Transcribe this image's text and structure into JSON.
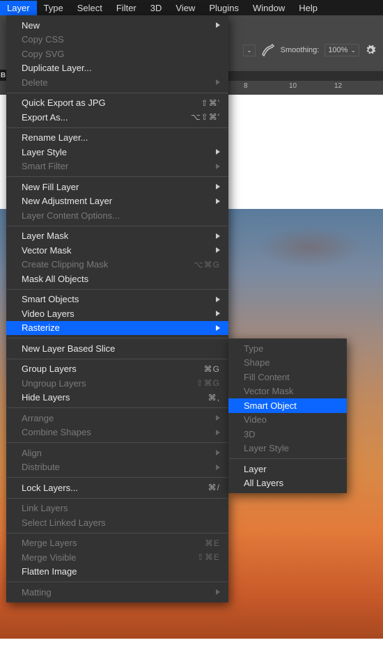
{
  "menubar": {
    "items": [
      {
        "label": "Layer"
      },
      {
        "label": "Type"
      },
      {
        "label": "Select"
      },
      {
        "label": "Filter"
      },
      {
        "label": "3D"
      },
      {
        "label": "View"
      },
      {
        "label": "Plugins"
      },
      {
        "label": "Window"
      },
      {
        "label": "Help"
      }
    ]
  },
  "toolbar": {
    "smoothing_label": "Smoothing:",
    "smoothing_value": "100%"
  },
  "ruler": {
    "marks": [
      "8",
      "10",
      "12"
    ]
  },
  "left_label": "B",
  "layer_menu": [
    {
      "label": "New",
      "arrow": true
    },
    {
      "label": "Copy CSS",
      "disabled": true
    },
    {
      "label": "Copy SVG",
      "disabled": true
    },
    {
      "label": "Duplicate Layer..."
    },
    {
      "label": "Delete",
      "disabled": true,
      "arrow": true
    },
    {
      "sep": true
    },
    {
      "label": "Quick Export as JPG",
      "shortcut": "⇧⌘'"
    },
    {
      "label": "Export As...",
      "shortcut": "⌥⇧⌘'"
    },
    {
      "sep": true
    },
    {
      "label": "Rename Layer..."
    },
    {
      "label": "Layer Style",
      "arrow": true
    },
    {
      "label": "Smart Filter",
      "disabled": true,
      "arrow": true
    },
    {
      "sep": true
    },
    {
      "label": "New Fill Layer",
      "arrow": true
    },
    {
      "label": "New Adjustment Layer",
      "arrow": true
    },
    {
      "label": "Layer Content Options...",
      "disabled": true
    },
    {
      "sep": true
    },
    {
      "label": "Layer Mask",
      "arrow": true
    },
    {
      "label": "Vector Mask",
      "arrow": true
    },
    {
      "label": "Create Clipping Mask",
      "shortcut": "⌥⌘G",
      "disabled": true
    },
    {
      "label": "Mask All Objects"
    },
    {
      "sep": true
    },
    {
      "label": "Smart Objects",
      "arrow": true
    },
    {
      "label": "Video Layers",
      "arrow": true
    },
    {
      "label": "Rasterize",
      "arrow": true,
      "highlight": true
    },
    {
      "sep": true
    },
    {
      "label": "New Layer Based Slice"
    },
    {
      "sep": true
    },
    {
      "label": "Group Layers",
      "shortcut": "⌘G"
    },
    {
      "label": "Ungroup Layers",
      "shortcut": "⇧⌘G",
      "disabled": true
    },
    {
      "label": "Hide Layers",
      "shortcut": "⌘,"
    },
    {
      "sep": true
    },
    {
      "label": "Arrange",
      "disabled": true,
      "arrow": true
    },
    {
      "label": "Combine Shapes",
      "disabled": true,
      "arrow": true
    },
    {
      "sep": true
    },
    {
      "label": "Align",
      "disabled": true,
      "arrow": true
    },
    {
      "label": "Distribute",
      "disabled": true,
      "arrow": true
    },
    {
      "sep": true
    },
    {
      "label": "Lock Layers...",
      "shortcut": "⌘/"
    },
    {
      "sep": true
    },
    {
      "label": "Link Layers",
      "disabled": true
    },
    {
      "label": "Select Linked Layers",
      "disabled": true
    },
    {
      "sep": true
    },
    {
      "label": "Merge Layers",
      "shortcut": "⌘E",
      "disabled": true
    },
    {
      "label": "Merge Visible",
      "shortcut": "⇧⌘E",
      "disabled": true
    },
    {
      "label": "Flatten Image"
    },
    {
      "sep": true
    },
    {
      "label": "Matting",
      "disabled": true,
      "arrow": true
    }
  ],
  "rasterize_submenu": [
    {
      "label": "Type",
      "disabled": true
    },
    {
      "label": "Shape",
      "disabled": true
    },
    {
      "label": "Fill Content",
      "disabled": true
    },
    {
      "label": "Vector Mask",
      "disabled": true
    },
    {
      "label": "Smart Object",
      "highlight": true
    },
    {
      "label": "Video",
      "disabled": true
    },
    {
      "label": "3D",
      "disabled": true
    },
    {
      "label": "Layer Style",
      "disabled": true
    },
    {
      "sep": true
    },
    {
      "label": "Layer"
    },
    {
      "label": "All Layers"
    }
  ]
}
